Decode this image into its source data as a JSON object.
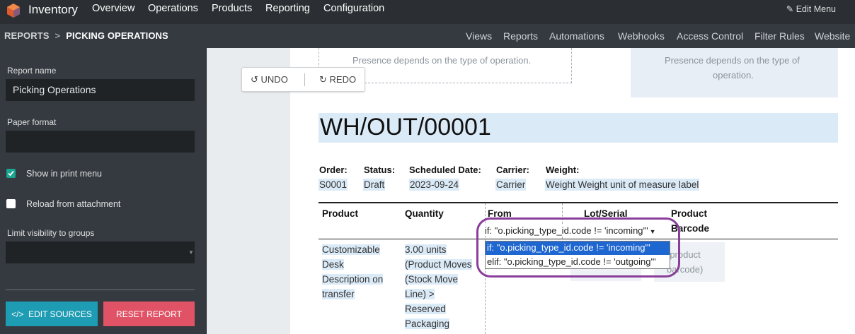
{
  "topbar": {
    "app_name": "Inventory",
    "menu": [
      "Overview",
      "Operations",
      "Products",
      "Reporting",
      "Configuration"
    ],
    "edit_menu": "Edit Menu",
    "edit_icon": "pencil-icon",
    "logo_colors": [
      "#e05c2a",
      "#875a7b"
    ]
  },
  "breadcrumb": {
    "parent": "REPORTS",
    "separator": ">",
    "current": "PICKING OPERATIONS"
  },
  "studio_links": [
    "Views",
    "Reports",
    "Automations",
    "Webhooks",
    "Access Control",
    "Filter Rules",
    "Website"
  ],
  "sidebar": {
    "report_name_label": "Report name",
    "report_name_value": "Picking Operations",
    "paper_format_label": "Paper format",
    "paper_format_value": "",
    "show_in_print_menu_label": "Show in print menu",
    "show_in_print_menu_checked": true,
    "reload_from_attachment_label": "Reload from attachment",
    "reload_from_attachment_checked": false,
    "limit_visibility_label": "Limit visibility to groups",
    "limit_visibility_value": "",
    "edit_sources_label": "EDIT SOURCES",
    "reset_report_label": "RESET REPORT"
  },
  "toolbar": {
    "undo_label": "UNDO",
    "redo_label": "REDO"
  },
  "report": {
    "note_left": "Presence depends on the type of operation.",
    "note_right_line1": "Presence depends on the type of",
    "note_right_line2": "operation.",
    "title": "WH/OUT/00001",
    "fields": [
      {
        "label": "Order:",
        "value": "S0001"
      },
      {
        "label": "Status:",
        "value": "Draft"
      },
      {
        "label": "Scheduled Date:",
        "value": "2023-09-24"
      },
      {
        "label": "Carrier:",
        "value": "Carrier"
      },
      {
        "label": "Weight:",
        "value": "Weight Weight unit of measure label"
      }
    ],
    "columns": [
      "Product",
      "Quantity",
      "From",
      "Lot/Serial",
      "Product",
      "Barcode"
    ],
    "row": {
      "product_lines": [
        "Customizable",
        "Desk",
        "Description on",
        "transfer"
      ],
      "quantity_lines": [
        "3.00 units",
        "(Product Moves",
        "(Stock Move",
        "Line) >",
        "Reserved",
        "Packaging"
      ],
      "barcode_placeholder_lines": [
        "(product",
        "barcode)"
      ]
    }
  },
  "condition_select": {
    "current": "if: \"o.picking_type_id.code != 'incoming'\"",
    "options": [
      "if: \"o.picking_type_id.code != 'incoming'\"",
      "elif: \"o.picking_type_id.code != 'outgoing'\""
    ],
    "selected_index": 0
  },
  "colors": {
    "navbar": "#2b2f33",
    "subbar": "#343a40",
    "accent_teal": "#1aa692",
    "edit_sources_bg": "#1e9cb3",
    "reset_bg": "#e05366",
    "highlight_blue": "#dbeaf7",
    "selection_blue": "#1e66d0",
    "ring_purple": "#8b3d9b"
  }
}
